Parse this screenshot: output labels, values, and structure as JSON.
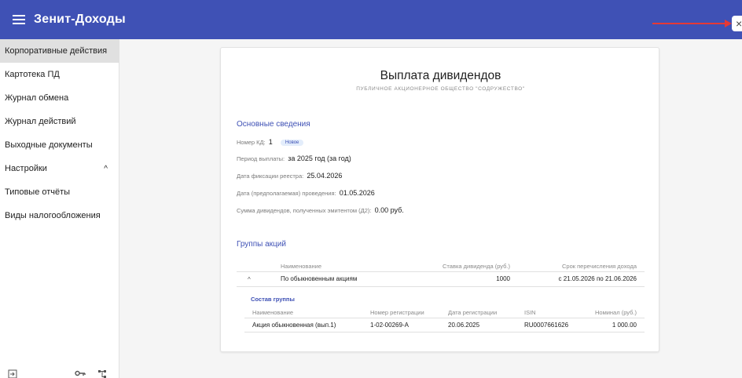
{
  "app": {
    "title": "Зенит-Доходы"
  },
  "icons": {
    "menu": "menu-icon",
    "close": "close-icon",
    "arrow": "red-arrow-annotation",
    "exit": "exit-icon",
    "key": "key-icon",
    "tree": "tree-icon",
    "expand": "chevron-up-icon"
  },
  "colors": {
    "primary": "#3f51b5",
    "annotation": "#e53935",
    "badge_bg": "#e3edfb"
  },
  "close_button": {
    "label": "×"
  },
  "sidebar": {
    "items": [
      {
        "label": "Корпоративные действия",
        "active": true
      },
      {
        "label": "Картотека ПД"
      },
      {
        "label": "Журнал обмена"
      },
      {
        "label": "Журнал действий"
      },
      {
        "label": "Выходные документы"
      },
      {
        "label": "Настройки",
        "chevron": "^"
      },
      {
        "label": "Типовые отчёты"
      },
      {
        "label": "Виды налогообложения"
      }
    ]
  },
  "card": {
    "title": "Выплата дивидендов",
    "subtitle": "ПУБЛИЧНОЕ АКЦИОНЕРНОЕ ОБЩЕСТВО \"СОДРУЖЕСТВО\"",
    "basic": {
      "title": "Основные сведения",
      "kd_label": "Номер КД:",
      "kd_value": "1",
      "kd_status": "Новое",
      "period_label": "Период выплаты:",
      "period_value": "за 2025 год (за год)",
      "fix_label": "Дата фиксации реестра:",
      "fix_value": "25.04.2026",
      "date_label": "Дата (предполагаемая) проведения:",
      "date_value": "01.05.2026",
      "sum_label": "Сумма дивидендов, полученных эмитентом (Д2):",
      "sum_value": "0.00 руб."
    },
    "groups": {
      "title": "Группы акций",
      "headers": {
        "name": "Наименование",
        "rate": "Ставка дивиденда (руб.)",
        "term": "Срок перечисления дохода"
      },
      "row": {
        "expand": "^",
        "name": "По обыкновенным акциям",
        "rate": "1000",
        "term": "с 21.05.2026 по 21.06.2026"
      },
      "composition": {
        "title": "Состав группы",
        "headers": {
          "name": "Наименование",
          "reg_no": "Номер регистрации",
          "reg_date": "Дата регистрации",
          "isin": "ISIN",
          "nominal": "Номинал (руб.)"
        },
        "row": {
          "name": "Акция обыкновенная (вып.1)",
          "reg_no": "1-02-00269-А",
          "reg_date": "20.06.2025",
          "isin": "RU0007661626",
          "nominal": "1 000.00"
        }
      }
    }
  }
}
